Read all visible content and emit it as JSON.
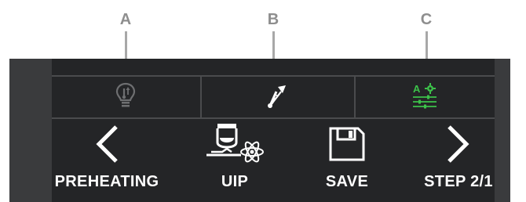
{
  "callouts": [
    "A",
    "B",
    "C"
  ],
  "status_icons": [
    {
      "icon": "lightbulb-temperature-icon",
      "color": "#6e6f71"
    },
    {
      "icon": "temperature-rising-icon",
      "color": "#ffffff"
    },
    {
      "icon": "auto-settings-sliders-icon",
      "color": "#3cc24a"
    }
  ],
  "buttons": [
    {
      "label": "PREHEATING",
      "icon": "chevron-left-icon"
    },
    {
      "label": "UIP",
      "icon": "uip-atom-icon"
    },
    {
      "label": "SAVE",
      "icon": "floppy-disk-icon"
    },
    {
      "label": "STEP 2/1",
      "icon": "chevron-right-icon"
    }
  ],
  "colors": {
    "panel": "#2d2e30",
    "screen": "#242527",
    "accent_green": "#3cc24a",
    "text": "#ffffff"
  }
}
